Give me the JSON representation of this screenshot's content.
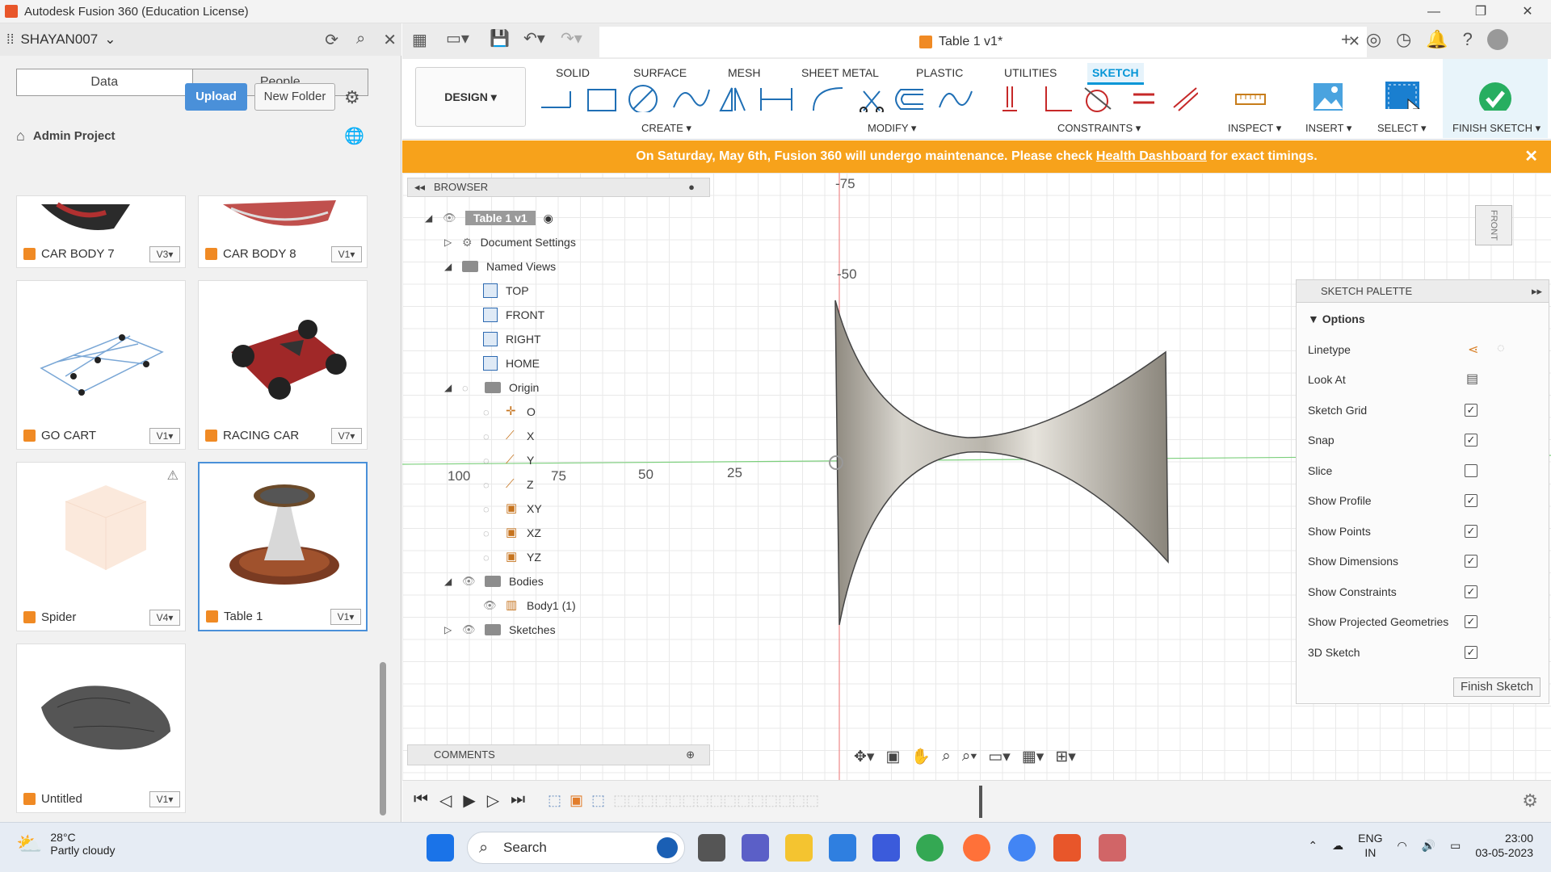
{
  "window": {
    "title": "Autodesk Fusion 360 (Education License)",
    "controls": [
      "—",
      "❐",
      "✕"
    ]
  },
  "data_panel": {
    "user": "SHAYAN007",
    "tabs": [
      "Data",
      "People"
    ],
    "upload_label": "Upload",
    "new_folder_label": "New Folder",
    "breadcrumb": "Admin Project",
    "items": [
      {
        "name": "CAR BODY 7",
        "version": "V3▾"
      },
      {
        "name": "CAR BODY 8",
        "version": "V1▾"
      },
      {
        "name": "GO CART",
        "version": "V1▾"
      },
      {
        "name": "RACING CAR",
        "version": "V7▾"
      },
      {
        "name": "Spider",
        "version": "V4▾"
      },
      {
        "name": "Table 1",
        "version": "V1▾"
      },
      {
        "name": "Untitled",
        "version": "V1▾"
      }
    ]
  },
  "document_tab": {
    "title": "Table 1 v1*"
  },
  "ribbon": {
    "workspace": "DESIGN ▾",
    "tabs": [
      "SOLID",
      "SURFACE",
      "MESH",
      "SHEET METAL",
      "PLASTIC",
      "UTILITIES",
      "SKETCH"
    ],
    "active_tab": "SKETCH",
    "groups": [
      "CREATE ▾",
      "MODIFY ▾",
      "CONSTRAINTS ▾",
      "INSPECT ▾",
      "INSERT ▾",
      "SELECT ▾",
      "FINISH SKETCH ▾"
    ]
  },
  "banner": {
    "text_before": "On Saturday, May 6th, Fusion 360 will undergo maintenance. Please check ",
    "link": "Health Dashboard",
    "text_after": " for exact timings."
  },
  "browser": {
    "title": "BROWSER",
    "root": "Table 1 v1",
    "nodes": [
      "Document Settings",
      "Named Views",
      "TOP",
      "FRONT",
      "RIGHT",
      "HOME",
      "Origin",
      "O",
      "X",
      "Y",
      "Z",
      "XY",
      "XZ",
      "YZ",
      "Bodies",
      "Body1 (1)",
      "Sketches"
    ]
  },
  "viewport": {
    "axis_labels": [
      "-75",
      "-50",
      "100",
      "75",
      "50",
      "25"
    ],
    "viewcube_label": "FRONT"
  },
  "sketch_palette": {
    "title": "SKETCH PALETTE",
    "section": "Options",
    "rows": [
      {
        "label": "Linetype",
        "checked": null
      },
      {
        "label": "Look At",
        "checked": null
      },
      {
        "label": "Sketch Grid",
        "checked": true
      },
      {
        "label": "Snap",
        "checked": true
      },
      {
        "label": "Slice",
        "checked": false
      },
      {
        "label": "Show Profile",
        "checked": true
      },
      {
        "label": "Show Points",
        "checked": true
      },
      {
        "label": "Show Dimensions",
        "checked": true
      },
      {
        "label": "Show Constraints",
        "checked": true
      },
      {
        "label": "Show Projected Geometries",
        "checked": true
      },
      {
        "label": "3D Sketch",
        "checked": true
      }
    ],
    "finish_label": "Finish Sketch"
  },
  "comments": {
    "title": "COMMENTS"
  },
  "taskbar": {
    "weather_temp": "28°C",
    "weather_cond": "Partly cloudy",
    "search_label": "Search",
    "lang1": "ENG",
    "lang2": "IN",
    "time": "23:00",
    "date": "03-05-2023"
  },
  "colors": {
    "accent": "#0696d7",
    "banner": "#f7a21b",
    "finish": "#27ae60",
    "upload": "#4a90d9"
  }
}
